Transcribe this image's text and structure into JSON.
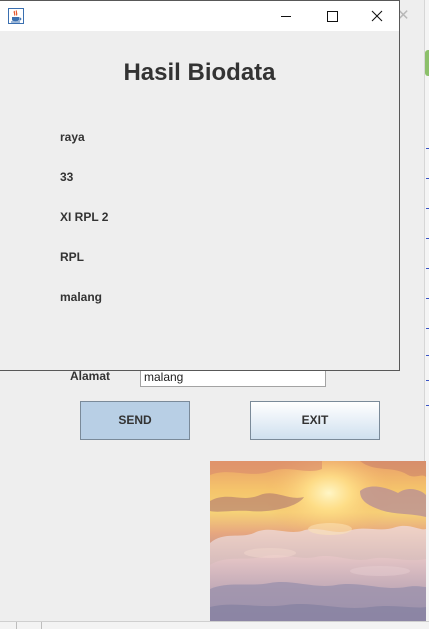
{
  "dialog": {
    "heading": "Hasil Biodata",
    "values": [
      "raya",
      "33",
      "XI RPL 2",
      "RPL",
      "malang"
    ]
  },
  "form": {
    "alamat_label": "Alamat",
    "alamat_value": "malang"
  },
  "buttons": {
    "send_label": "SEND",
    "exit_label": "EXIT"
  },
  "icons": {
    "app": "java-cup-icon",
    "minimize": "minimize-icon",
    "maximize": "maximize-icon",
    "close": "close-icon",
    "background_close": "close-icon"
  },
  "colors": {
    "send_button_bg": "#b8cfe5",
    "window_bg": "#eeeeee",
    "titlebar_bg": "#ffffff"
  }
}
